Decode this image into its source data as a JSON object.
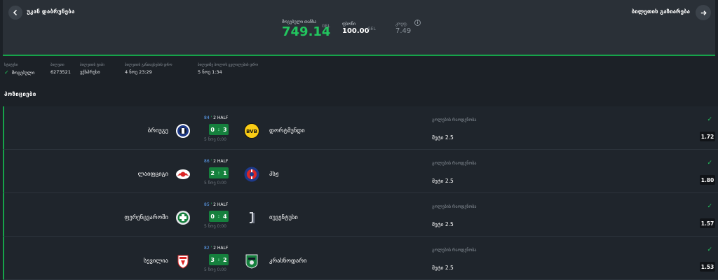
{
  "header": {
    "back_label": "უკან დაბრუნება",
    "share_label": "ბილეთის გაზიარება",
    "win": {
      "caption": "მოგებული თანხა",
      "value": "749.14",
      "currency": "GEL"
    },
    "stake": {
      "caption": "ფსონი",
      "value": "100.00",
      "currency": "GEL"
    },
    "coef": {
      "caption": "კოეფ.",
      "value": "7.49"
    },
    "icons": {
      "back": "arrow-left-icon",
      "share": "share-arrow-icon",
      "info": "info-icon"
    },
    "colors": {
      "accent": "#22c55e",
      "header_bg": "#2a3037",
      "page_bg": "#1c2127"
    }
  },
  "details": [
    {
      "caption": "სტატუსი",
      "value": "მოგებული"
    },
    {
      "caption": "ბილეთი",
      "value": "6273521"
    },
    {
      "caption": "ბილეთის ტიპი",
      "value": "ექსპრესი"
    },
    {
      "caption": "ბილეთის განთავსების დრო",
      "value": "4 ნოე 23:29"
    },
    {
      "caption": "ბილეთზე ბოლოს ცვლილების დრო",
      "value": "5 ნოე 1:34"
    }
  ],
  "section_title": "პოზიციები",
  "matches": [
    {
      "home": "ბრიუგე",
      "away": "დორტმუნდი",
      "minute": "84",
      "half": "2 HALF",
      "home_score": "0",
      "away_score": "3",
      "date": "5 ნოე 0:00",
      "market": "გოლების რაოდენობა",
      "pick": "მეტი 2.5",
      "odds": "1.72",
      "home_logo": "club-brugge-logo",
      "away_logo": "bvb-logo"
    },
    {
      "home": "ლაიფციგი",
      "away": "პსჟ",
      "minute": "86",
      "half": "2 HALF",
      "home_score": "2",
      "away_score": "1",
      "date": "5 ნოე 0:00",
      "market": "გოლების რაოდენობა",
      "pick": "მეტი 2.5",
      "odds": "1.80",
      "home_logo": "rb-leipzig-logo",
      "away_logo": "psg-logo"
    },
    {
      "home": "ფერენცვაროში",
      "away": "იუვენტუსი",
      "minute": "85",
      "half": "2 HALF",
      "home_score": "0",
      "away_score": "4",
      "date": "5 ნოე 0:00",
      "market": "გოლების რაოდენობა",
      "pick": "მეტი 2.5",
      "odds": "1.57",
      "home_logo": "ferencvaros-logo",
      "away_logo": "juventus-logo"
    },
    {
      "home": "სევილია",
      "away": "კრასნოდარი",
      "minute": "82",
      "half": "2 HALF",
      "home_score": "3",
      "away_score": "2",
      "date": "5 ნოე 0:00",
      "market": "გოლების რაოდენობა",
      "pick": "მეტი 2.5",
      "odds": "1.53",
      "home_logo": "sevilla-logo",
      "away_logo": "krasnodar-logo"
    }
  ]
}
